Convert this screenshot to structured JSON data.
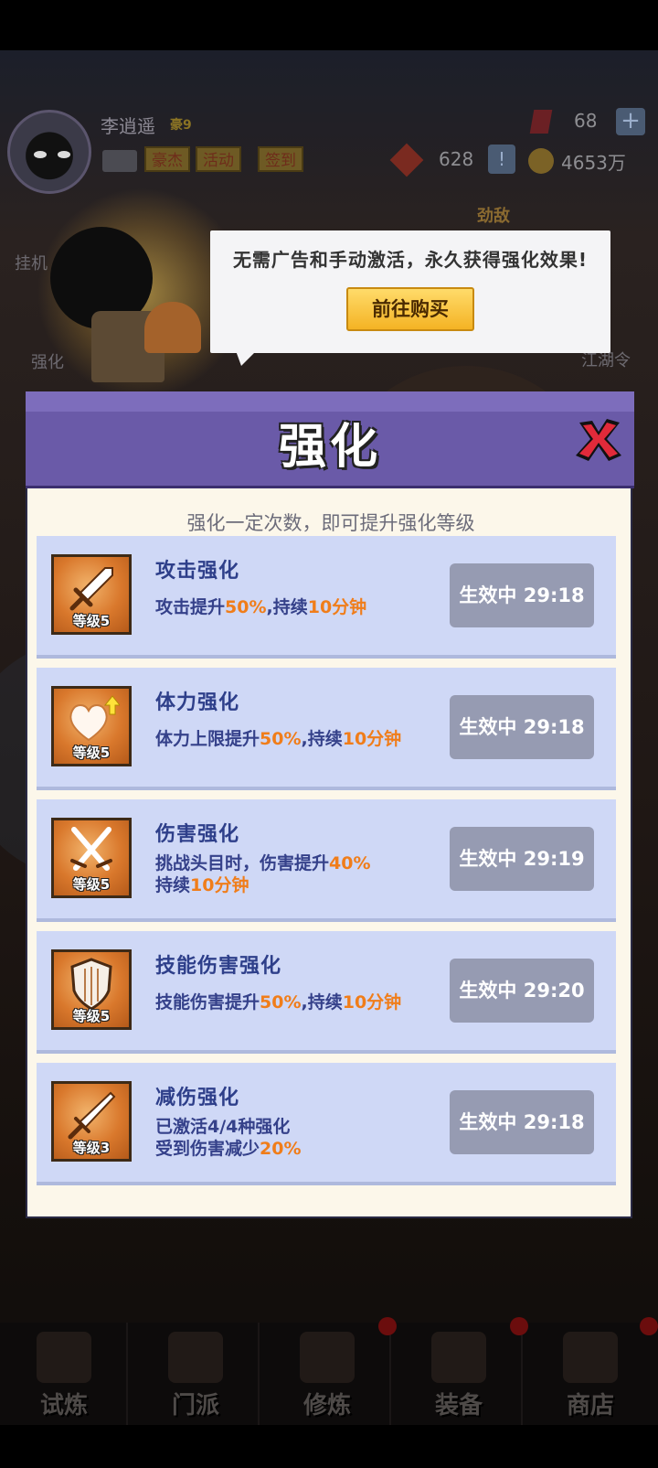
{
  "player": {
    "name": "李逍遥",
    "vip": "豪9",
    "tags": [
      "豪杰",
      "活动",
      "签到"
    ]
  },
  "currency": {
    "gems": "68",
    "tokens": "628",
    "coins": "4653万"
  },
  "side_labels": {
    "idle": "挂机",
    "boost": "强化",
    "rival": "劲敌",
    "order": "江湖令"
  },
  "promo": {
    "text": "无需广告和手动激活，永久获得强化效果!",
    "button": "前往购买"
  },
  "modal": {
    "title": "强化",
    "subtitle": "强化一定次数，即可提升强化等级",
    "cards": [
      {
        "icon": "sword-icon",
        "level": "等级5",
        "title": "攻击强化",
        "desc": [
          {
            "a": "攻击提升",
            "b": "50%",
            "c": ",持续",
            "d": "10分钟"
          }
        ],
        "status": "生效中 29:18"
      },
      {
        "icon": "heart-up-icon",
        "level": "等级5",
        "title": "体力强化",
        "desc": [
          {
            "a": "体力上限提升",
            "b": "50%",
            "c": ",持续",
            "d": "10分钟"
          }
        ],
        "status": "生效中 29:18"
      },
      {
        "icon": "crossed-swords-icon",
        "level": "等级5",
        "title": "伤害强化",
        "desc": [
          {
            "a": "挑战头目时，伤害提升",
            "b": "40%"
          },
          {
            "a": "持续",
            "b": "10分钟"
          }
        ],
        "status": "生效中 29:19"
      },
      {
        "icon": "shield-icon",
        "level": "等级5",
        "title": "技能伤害强化",
        "desc": [
          {
            "a": "技能伤害提升",
            "b": "50%",
            "c": ",持续",
            "d": "10分钟"
          }
        ],
        "status": "生效中 29:20"
      },
      {
        "icon": "dagger-icon",
        "level": "等级3",
        "title": "减伤强化",
        "desc": [
          {
            "a": "已激活4/4种强化"
          },
          {
            "a": "受到伤害减少",
            "b": "20%"
          }
        ],
        "status": "生效中 29:18"
      }
    ]
  },
  "nav": [
    "试炼",
    "门派",
    "修炼",
    "装备",
    "商店"
  ],
  "colors": {
    "modal_header": "#6a5aa8",
    "card_bg": "#cfd8f6",
    "highlight": "#f07d1a",
    "status_button": "#969bb2",
    "buy_button": "#f4b324"
  }
}
